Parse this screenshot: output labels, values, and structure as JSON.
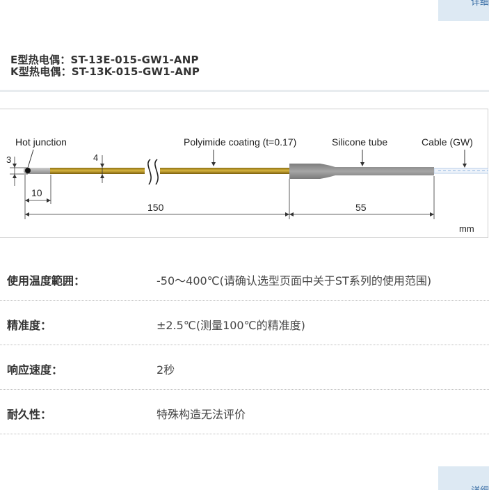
{
  "buttons": {
    "top_detail": "详细",
    "bottom_detail": "详细"
  },
  "product": {
    "model_e": "E型热电偶：ST-13E-015-GW1-ANP",
    "model_k": "K型热电偶：ST-13K-015-GW1-ANP"
  },
  "diagram": {
    "labels": {
      "hot_junction": "Hot junction",
      "coating": "Polyimide coating (t=0.17)",
      "silicone": "Silicone tube",
      "cable": "Cable (GW)",
      "unit": "mm"
    },
    "dims": {
      "d3": "3",
      "d4": "4",
      "d10": "10",
      "d150": "150",
      "d55": "55"
    },
    "colors": {
      "probe_gold": "#c9a227",
      "tube_gray": "#9b9b9b",
      "cable_blue": "#8fb4e0"
    }
  },
  "specs": [
    {
      "label": "使用温度範囲：",
      "value": "-50～400℃(请确认选型页面中关于ST系列的使用范围)"
    },
    {
      "label": "精准度：",
      "value": "±2.5℃(测量100℃的精准度)"
    },
    {
      "label": "响应速度：",
      "value": "2秒"
    },
    {
      "label": "耐久性：",
      "value": "特殊构造无法评价"
    }
  ]
}
